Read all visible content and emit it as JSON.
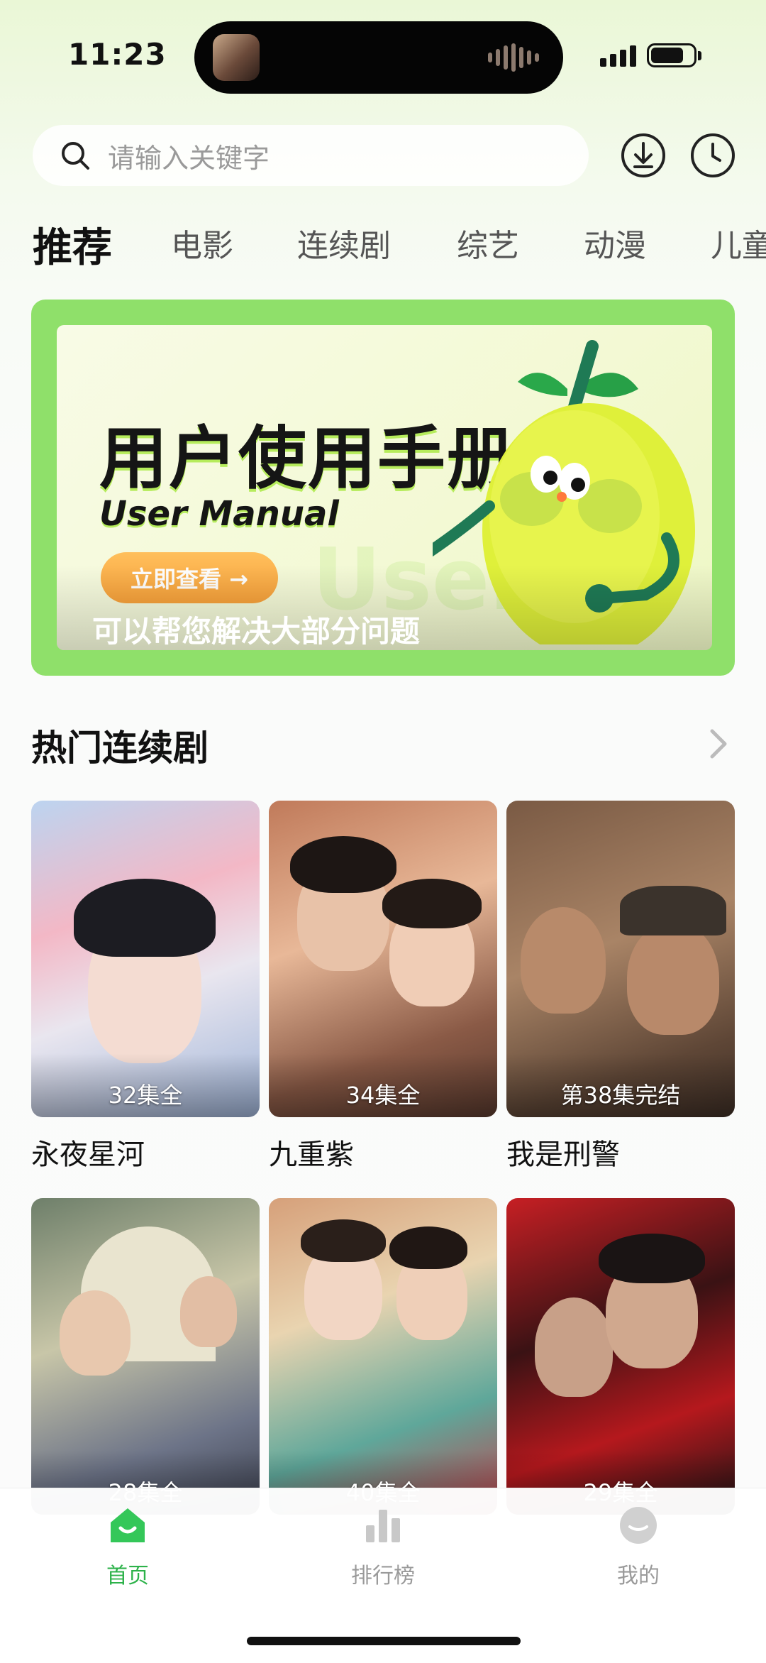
{
  "status_bar": {
    "time": "11:23"
  },
  "search": {
    "placeholder": "请输入关键字"
  },
  "tabs": [
    "推荐",
    "电影",
    "连续剧",
    "综艺",
    "动漫",
    "儿童"
  ],
  "banner": {
    "title": "用户使用手册",
    "subtitle": "User Manual",
    "button_label": "立即查看 →",
    "caption": "可以帮您解决大部分问题"
  },
  "section": {
    "title": "热门连续剧"
  },
  "dramas": [
    {
      "title": "永夜星河",
      "badge": "32集全"
    },
    {
      "title": "九重紫",
      "badge": "34集全"
    },
    {
      "title": "我是刑警",
      "badge": "第38集完结"
    },
    {
      "title": "",
      "badge": "28集全"
    },
    {
      "title": "",
      "badge": "40集全"
    },
    {
      "title": "",
      "badge": "29集全"
    }
  ],
  "bottom_nav": [
    {
      "label": "首页",
      "icon": "home-icon",
      "active": true
    },
    {
      "label": "排行榜",
      "icon": "ranking-icon",
      "active": false
    },
    {
      "label": "我的",
      "icon": "profile-icon",
      "active": false
    }
  ],
  "colors": {
    "accent": "#2db24a",
    "banner_green": "#8fe06a",
    "button_orange": "#f7a13a"
  }
}
